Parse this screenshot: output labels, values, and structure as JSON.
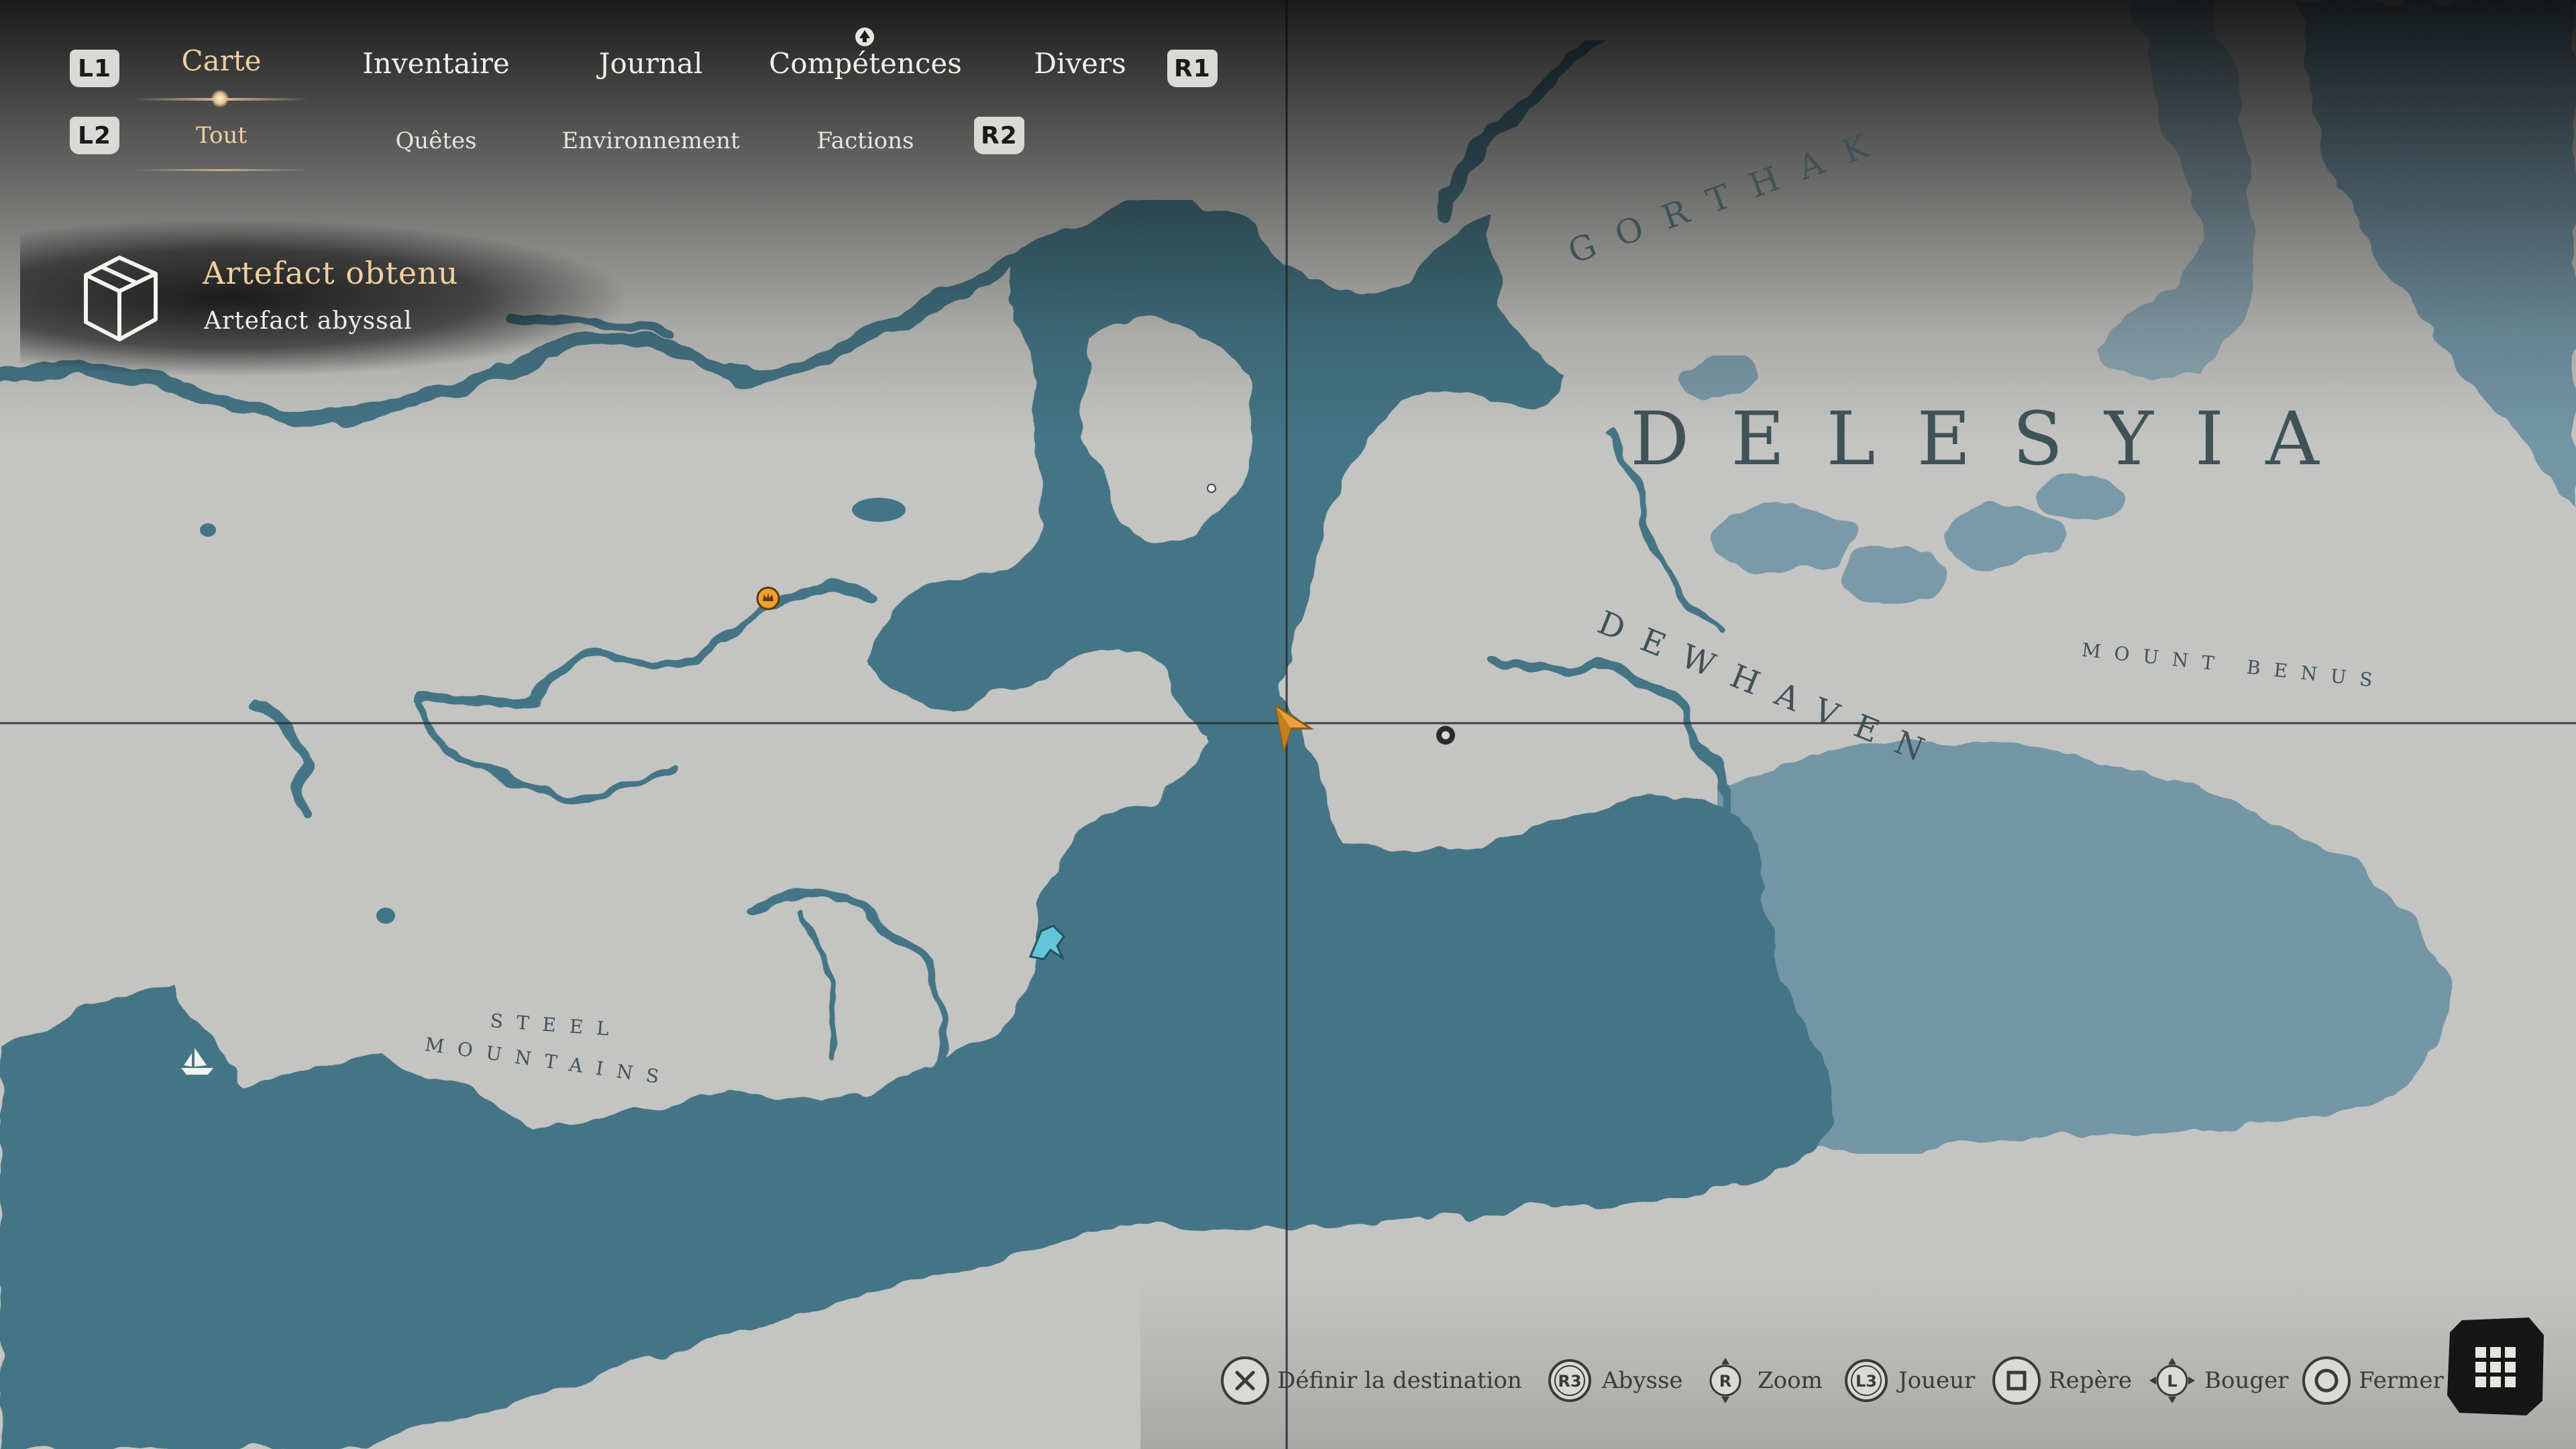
{
  "nav": {
    "left_bumper": "L1",
    "right_bumper": "R1",
    "left_trigger": "L2",
    "right_trigger": "R2",
    "main_tabs": [
      {
        "label": "Carte",
        "active": true
      },
      {
        "label": "Inventaire",
        "active": false
      },
      {
        "label": "Journal",
        "active": false
      },
      {
        "label": "Compétences",
        "active": false
      },
      {
        "label": "Divers",
        "active": false
      }
    ],
    "sub_tabs": [
      {
        "label": "Tout",
        "active": true
      },
      {
        "label": "Quêtes",
        "active": false
      },
      {
        "label": "Environnement",
        "active": false
      },
      {
        "label": "Factions",
        "active": false
      }
    ]
  },
  "notification": {
    "title": "Artefact obtenu",
    "subtitle": "Artefact abyssal",
    "icon": "artifact-cube-icon"
  },
  "map": {
    "labels": {
      "delesyia": "DELESYIA",
      "gorthak": "GORTHAK",
      "dewhaven": "DEWHAVEN",
      "mount_benus": "MOUNT BENUS",
      "steel": "STEEL",
      "mountains": "MOUNTAINS"
    },
    "colors": {
      "land": "#c4c4c2",
      "water": "#3f7384",
      "far_water": "#7195a6",
      "player_marker": "#e8a23a",
      "crosshair": "#2a2a2a"
    }
  },
  "controls": [
    {
      "button": "✕",
      "label": "Définir la destination",
      "icon": "cross-button-icon"
    },
    {
      "button": "R3",
      "label": "Abysse",
      "icon": "r3-stick-icon"
    },
    {
      "button": "R",
      "label": "Zoom",
      "icon": "right-stick-icon"
    },
    {
      "button": "L3",
      "label": "Joueur",
      "icon": "l3-stick-icon"
    },
    {
      "button": "□",
      "label": "Repère",
      "icon": "square-button-icon"
    },
    {
      "button": "L",
      "label": "Bouger",
      "icon": "left-stick-icon"
    },
    {
      "button": "○",
      "label": "Fermer",
      "icon": "circle-button-icon"
    }
  ]
}
